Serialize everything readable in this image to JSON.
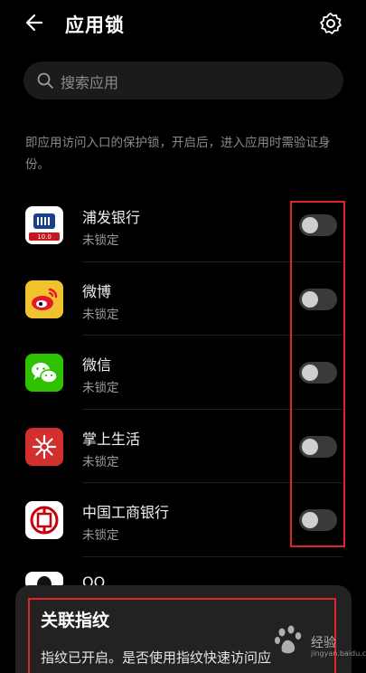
{
  "header": {
    "title": "应用锁",
    "back_icon": "back-arrow-icon",
    "settings_icon": "gear-icon"
  },
  "search": {
    "placeholder": "搜索应用",
    "icon": "search-icon"
  },
  "description": "即应用访问入口的保护锁，开启后，进入应用时需验证身份。",
  "apps": [
    {
      "name": "浦发银行",
      "status": "未锁定",
      "icon": "spdb-app-icon",
      "locked": false
    },
    {
      "name": "微博",
      "status": "未锁定",
      "icon": "weibo-app-icon",
      "locked": false
    },
    {
      "name": "微信",
      "status": "未锁定",
      "icon": "wechat-app-icon",
      "locked": false
    },
    {
      "name": "掌上生活",
      "status": "未锁定",
      "icon": "zhangshang-shenghuo-app-icon",
      "locked": false
    },
    {
      "name": "中国工商银行",
      "status": "未锁定",
      "icon": "icbc-app-icon",
      "locked": false
    }
  ],
  "partial_app": {
    "name": "QQ",
    "icon": "qq-app-icon"
  },
  "dialog": {
    "title": "关联指纹",
    "body": "指纹已开启。是否使用指纹快速访问应"
  },
  "colors": {
    "background": "#000000",
    "annotation_red": "#e0242b",
    "toggle_off": "#3a3a3a"
  },
  "watermark": {
    "brand": "经验",
    "url": "jingyan.baidu.com"
  }
}
